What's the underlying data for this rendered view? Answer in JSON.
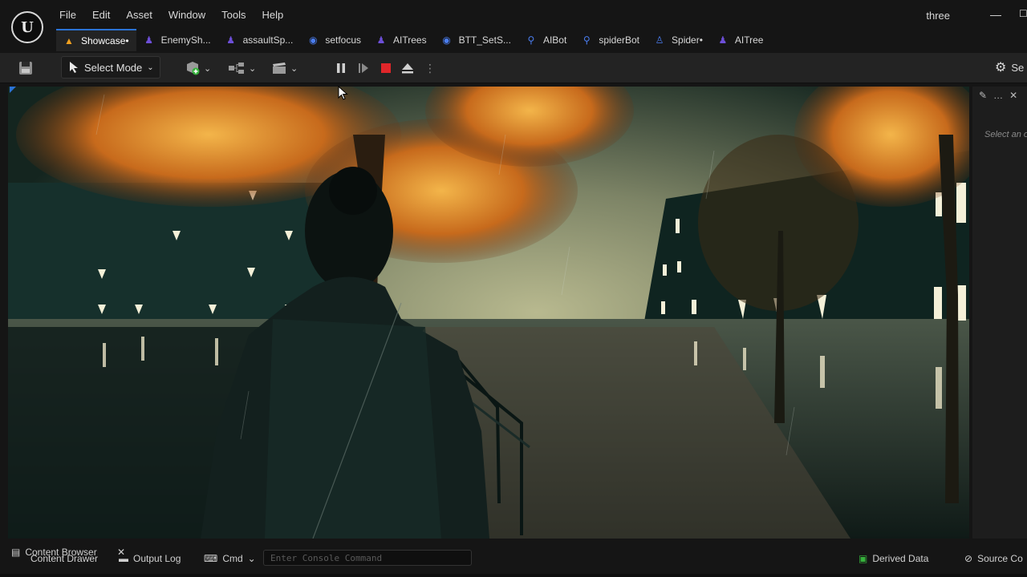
{
  "app": {
    "logo_text": "U",
    "project_name": "three"
  },
  "menu": [
    "File",
    "Edit",
    "Asset",
    "Window",
    "Tools",
    "Help"
  ],
  "tabs": [
    {
      "label": "Showcase•",
      "icon": "level-icon",
      "active": true
    },
    {
      "label": "EnemySh...",
      "icon": "blueprint-icon"
    },
    {
      "label": "assaultSp...",
      "icon": "blueprint-icon"
    },
    {
      "label": "setfocus",
      "icon": "behavior-tree-task-icon"
    },
    {
      "label": "AITrees",
      "icon": "blueprint-icon"
    },
    {
      "label": "BTT_SetS...",
      "icon": "behavior-tree-task-icon"
    },
    {
      "label": "AIBot",
      "icon": "ai-controller-icon"
    },
    {
      "label": "spiderBot",
      "icon": "ai-controller-icon"
    },
    {
      "label": "Spider•",
      "icon": "character-icon"
    },
    {
      "label": "AITree",
      "icon": "blueprint-icon"
    }
  ],
  "toolbar": {
    "select_mode_label": "Select Mode",
    "settings_label": "Se"
  },
  "details_panel": {
    "hint": "Select an o"
  },
  "statusbar": {
    "content_browser_label": "Content Browser",
    "content_drawer_label": "Content Drawer",
    "output_log_label": "Output Log",
    "cmd_label": "Cmd",
    "console_placeholder": "Enter Console Command",
    "derived_data_label": "Derived Data",
    "source_control_label": "Source Co"
  },
  "colors": {
    "accent_blue": "#2b73d6",
    "stop_red": "#e0262a",
    "blueprint_purple": "#6d4fd8",
    "level_orange": "#f0a020"
  }
}
